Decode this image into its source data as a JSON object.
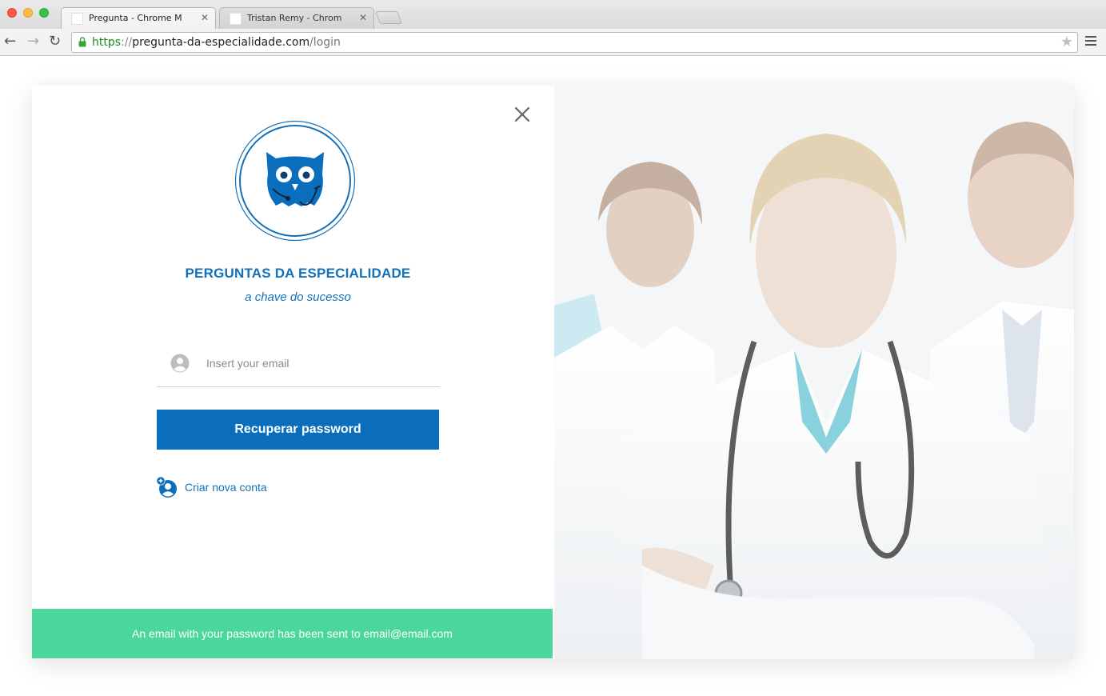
{
  "browser": {
    "tabs": [
      {
        "title": "Pregunta - Chrome M",
        "active": true
      },
      {
        "title": "Tristan Remy - Chrome M",
        "active": false
      }
    ],
    "url": {
      "scheme": "https",
      "separator": "://",
      "host": "pregunta-da-especialidade.com",
      "path": "/login"
    }
  },
  "login": {
    "brand_title": "PERGUNTAS DA ESPECIALIDADE",
    "brand_subtitle": "a chave do sucesso",
    "email_placeholder": "Insert your email",
    "email_value": "",
    "recover_button": "Recuperar password",
    "create_account": "Criar nova conta",
    "toast_message": "An email with your password has been sent to email@email.com"
  },
  "colors": {
    "brand_blue": "#0b6ebd",
    "success_green": "#4bd69c"
  },
  "icons": {
    "close": "close-icon",
    "logo": "owl-stethoscope-logo",
    "user": "user-circle-icon",
    "add_user": "add-user-icon"
  }
}
